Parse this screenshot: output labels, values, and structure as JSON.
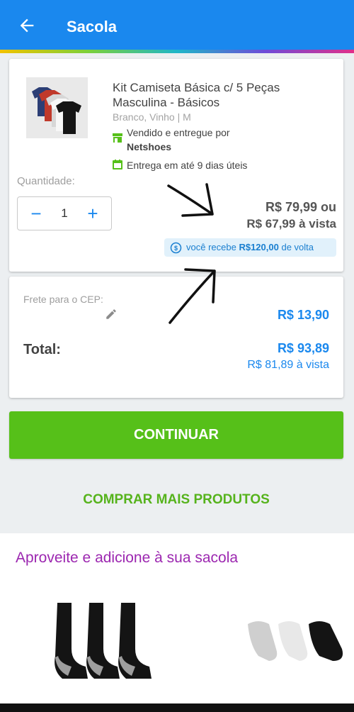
{
  "header": {
    "title": "Sacola",
    "back_icon": "arrow-left-icon"
  },
  "colors": {
    "primary": "#1a88ee",
    "success": "#56c019",
    "accent_purple": "#9c27b0"
  },
  "product": {
    "title": "Kit Camiseta Básica c/ 5 Peças Masculina - Básicos",
    "variant": "Branco, Vinho | M",
    "seller_prefix": "Vendido e entregue por",
    "seller_name": "Netshoes",
    "delivery": "Entrega em até 9 dias úteis",
    "quantity_label": "Quantidade:",
    "quantity": "1",
    "price": "R$ 79,99 ou",
    "price_vista": "R$ 67,99 à vista",
    "cashback_prefix": "você recebe",
    "cashback_value": "R$120,00",
    "cashback_suffix": "de volta"
  },
  "summary": {
    "frete_label": "Frete para o CEP:",
    "frete_value": "R$ 13,90",
    "total_label": "Total:",
    "total_value": "R$ 93,89",
    "total_vista": "R$ 81,89 à vista"
  },
  "actions": {
    "continue_label": "CONTINUAR",
    "more_products_label": "COMPRAR MAIS PRODUTOS"
  },
  "recommendations": {
    "title": "Aproveite e adicione à sua sacola"
  }
}
